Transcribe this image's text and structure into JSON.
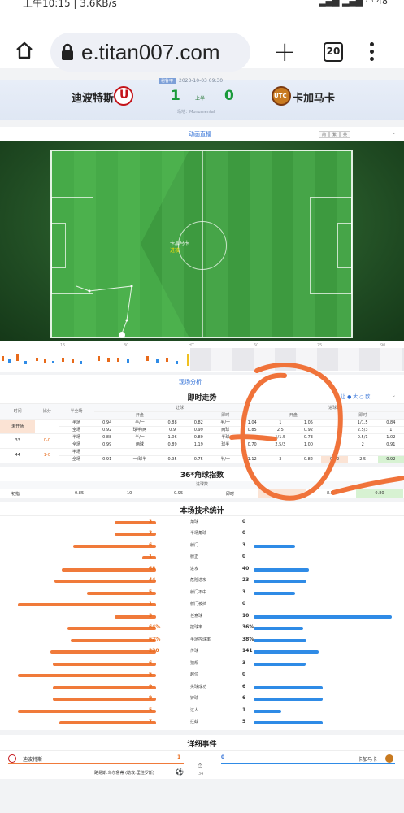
{
  "status_bar": {
    "time_text": "上午10:15 | 3.6KB/s",
    "battery": "48"
  },
  "browser": {
    "url": "e.titan007.com",
    "tab_count": "20"
  },
  "match": {
    "league_badge": "秘鲁甲",
    "date": "2023-10-03 09:30",
    "home_team": "迪波特斯",
    "away_team": "卡加马卡",
    "home_score": "1",
    "away_score": "0",
    "half_label": "上半",
    "venue": "场地：Monumental"
  },
  "live_section": {
    "tab": "动画直播",
    "toggles": [
      "简",
      "繁",
      "英"
    ]
  },
  "pitch": {
    "event_team": "卡加马卡",
    "event_text": "进攻"
  },
  "timeline": {
    "ticks": [
      "15",
      "30",
      "HT",
      "60",
      "75",
      "90"
    ]
  },
  "analysis_tab": "现场分析",
  "odds": {
    "title": "即时走势",
    "options": [
      "让",
      "大",
      "欧"
    ],
    "head": [
      "时间",
      "比分",
      "半全场",
      "让球",
      "进球数"
    ],
    "sub_head": [
      "开盘",
      "即时",
      "开盘",
      "即时"
    ],
    "rows": [
      {
        "time": "未开场",
        "score": "",
        "rows": [
          [
            "半场",
            "0.94",
            "半/一",
            "0.88",
            "0.82",
            "半/一",
            "1.04",
            "",
            "1",
            "1.05",
            "",
            "1/1.5",
            "0.84"
          ],
          [
            "全场",
            "0.92",
            "球半/两",
            "0.9",
            "0.99",
            "两球",
            "0.85",
            "",
            "2.5",
            "0.92",
            "",
            "2.5/3",
            "1"
          ]
        ]
      },
      {
        "time": "33",
        "score": "0-0",
        "rows": [
          [
            "半场",
            "0.88",
            "半/一",
            "1.06",
            "0.80",
            "半球",
            "1.04",
            "",
            "1/1.5",
            "0.73",
            "",
            "0.5/1",
            "1.02"
          ],
          [
            "全场",
            "0.99",
            "两球",
            "0.89",
            "1.19",
            "球半",
            "0.70",
            "",
            "2.5/3",
            "1.00",
            "",
            "2",
            "0.91"
          ]
        ]
      },
      {
        "time": "44",
        "score": "1-0",
        "rows": [
          [
            "半场",
            "",
            "",
            "",
            "",
            "",
            "",
            "",
            "",
            "",
            "",
            "",
            ""
          ],
          [
            "全场",
            "0.91",
            "一/球半",
            "0.95",
            "0.75",
            "半/一",
            "1.12",
            "",
            "3",
            "0.82",
            "0.92",
            "2.5",
            "0.92"
          ]
        ]
      }
    ]
  },
  "corners": {
    "title": "36*角球指数",
    "sub": "进球数",
    "row": [
      "初指",
      "0.85",
      "10",
      "0.95",
      "即时",
      "8.5",
      "0.80"
    ]
  },
  "stats": {
    "title": "本场技术统计",
    "items": [
      {
        "name": "角球",
        "home": "3",
        "away": "0",
        "h": 3,
        "a": 0,
        "hmax": 10
      },
      {
        "name": "半场角球",
        "home": "3",
        "away": "0",
        "h": 3,
        "a": 0,
        "hmax": 10
      },
      {
        "name": "射门",
        "home": "6",
        "away": "3",
        "h": 6,
        "a": 3,
        "hmax": 10
      },
      {
        "name": "射正",
        "home": "1",
        "away": "0",
        "h": 1,
        "a": 0,
        "hmax": 10
      },
      {
        "name": "进攻",
        "home": "68",
        "away": "40",
        "h": 68,
        "a": 40,
        "hmax": 100
      },
      {
        "name": "危险进攻",
        "home": "44",
        "away": "23",
        "h": 44,
        "a": 23,
        "hmax": 60
      },
      {
        "name": "射门不中",
        "home": "5",
        "away": "3",
        "h": 5,
        "a": 3,
        "hmax": 10
      },
      {
        "name": "射门被挡",
        "home": "1",
        "away": "0",
        "h": 1,
        "a": 0,
        "hmax": 1
      },
      {
        "name": "任意球",
        "home": "3",
        "away": "10",
        "h": 3,
        "a": 10,
        "hmax": 10
      },
      {
        "name": "控球率",
        "home": "64%",
        "away": "36%",
        "h": 64,
        "a": 36,
        "hmax": 100
      },
      {
        "name": "半场控球率",
        "home": "62%",
        "away": "38%",
        "h": 62,
        "a": 38,
        "hmax": 100
      },
      {
        "name": "传球",
        "home": "230",
        "away": "141",
        "h": 230,
        "a": 141,
        "hmax": 300
      },
      {
        "name": "犯规",
        "home": "6",
        "away": "3",
        "h": 6,
        "a": 3,
        "hmax": 8
      },
      {
        "name": "越位",
        "home": "5",
        "away": "0",
        "h": 5,
        "a": 0,
        "hmax": 5
      },
      {
        "name": "头球成功",
        "home": "9",
        "away": "6",
        "h": 9,
        "a": 6,
        "hmax": 12
      },
      {
        "name": "铲球",
        "home": "9",
        "away": "6",
        "h": 9,
        "a": 6,
        "hmax": 12
      },
      {
        "name": "过人",
        "home": "5",
        "away": "1",
        "h": 5,
        "a": 1,
        "hmax": 5
      },
      {
        "name": "拦截",
        "home": "7",
        "away": "5",
        "h": 7,
        "a": 5,
        "hmax": 10
      }
    ]
  },
  "details": {
    "title": "详细事件",
    "home_team": "迪波特斯",
    "home_score": "1",
    "away_team": "卡加马卡",
    "away_score": "0",
    "event_text": "路易斯.乌尔鲁蒂 (助攻:里佳罗斯)",
    "event_minute": "34"
  }
}
